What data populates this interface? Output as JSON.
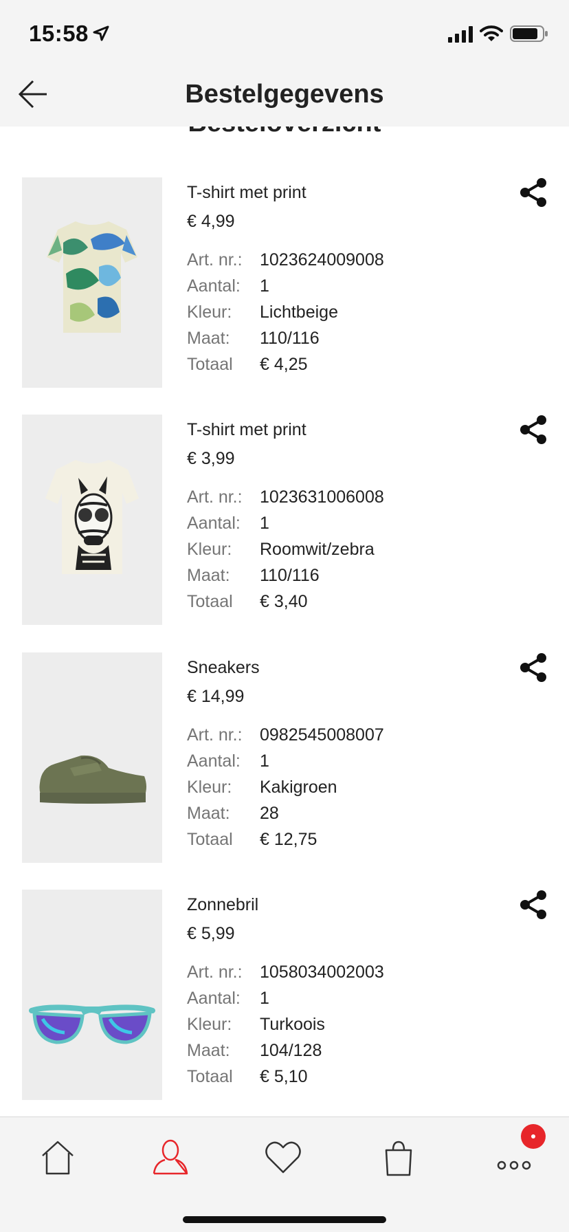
{
  "status_bar": {
    "time": "15:58"
  },
  "header": {
    "title": "Bestelgegevens",
    "back_icon": "arrow-left-icon"
  },
  "section": {
    "title": "Besteloverzicht"
  },
  "labels": {
    "art_nr": "Art. nr.:",
    "aantal": "Aantal:",
    "kleur": "Kleur:",
    "maat": "Maat:",
    "totaal": "Totaal"
  },
  "items": [
    {
      "name": "T-shirt met print",
      "price": "€ 4,99",
      "art_nr": "1023624009008",
      "aantal": "1",
      "kleur": "Lichtbeige",
      "maat": "110/116",
      "totaal": "€ 4,25"
    },
    {
      "name": "T-shirt met print",
      "price": "€ 3,99",
      "art_nr": "1023631006008",
      "aantal": "1",
      "kleur": "Roomwit/zebra",
      "maat": "110/116",
      "totaal": "€ 3,40"
    },
    {
      "name": "Sneakers",
      "price": "€ 14,99",
      "art_nr": "0982545008007",
      "aantal": "1",
      "kleur": "Kakigroen",
      "maat": "28",
      "totaal": "€ 12,75"
    },
    {
      "name": "Zonnebril",
      "price": "€ 5,99",
      "art_nr": "1058034002003",
      "aantal": "1",
      "kleur": "Turkoois",
      "maat": "104/128",
      "totaal": "€ 5,10"
    }
  ],
  "nav": {
    "items": [
      "home-icon",
      "account-icon",
      "heart-icon",
      "shopping-bag-icon",
      "more-icon"
    ],
    "active": "account-icon"
  },
  "colors": {
    "accent": "#e7262a",
    "background": "#ffffff",
    "bar": "#f4f4f4",
    "muted_text": "#757575"
  }
}
